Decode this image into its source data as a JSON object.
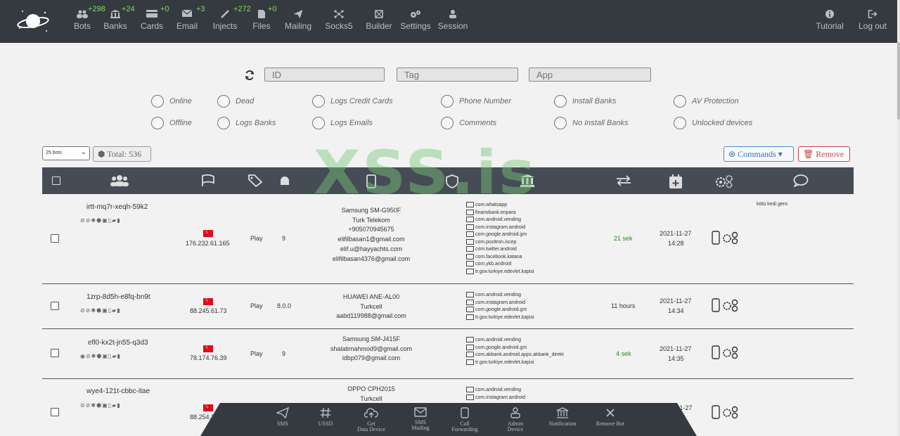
{
  "nav": [
    {
      "label": "Bots",
      "badge": "+298",
      "icon": "users-icon"
    },
    {
      "label": "Banks",
      "badge": "+24",
      "icon": "bank-icon"
    },
    {
      "label": "Cards",
      "badge": "+0",
      "icon": "card-icon"
    },
    {
      "label": "Email",
      "badge": "+3",
      "icon": "envelope-icon"
    },
    {
      "label": "Injects",
      "badge": "+272",
      "icon": "syringe-icon"
    },
    {
      "label": "Files",
      "badge": "+0",
      "icon": "file-icon"
    },
    {
      "label": "Mailing",
      "badge": "",
      "icon": "paper-plane-icon"
    },
    {
      "label": "Socks5",
      "badge": "",
      "icon": "network-icon"
    },
    {
      "label": "Builder",
      "badge": "",
      "icon": "cube-icon"
    },
    {
      "label": "Settings",
      "badge": "",
      "icon": "gears-icon"
    },
    {
      "label": "Session",
      "badge": "",
      "icon": "user-icon"
    }
  ],
  "nav_right": [
    {
      "label": "Tutorial",
      "icon": "info-icon"
    },
    {
      "label": "Log out",
      "icon": "logout-icon"
    }
  ],
  "filters": {
    "id_placeholder": "ID",
    "tag_placeholder": "Tag",
    "app_placeholder": "App"
  },
  "radios": {
    "online": "Online",
    "offline": "Offline",
    "dead": "Dead",
    "logs_banks": "Logs Banks",
    "logs_cc": "Logs Credit Cards",
    "logs_emails": "Logs Emails",
    "phone_number": "Phone Number",
    "comments": "Comments",
    "install_banks": "Install Banks",
    "no_install_banks": "No Install Banks",
    "av_protection": "AV Protection",
    "unlocked": "Unlocked devices"
  },
  "toolbar": {
    "per_page": "25 bots",
    "total": "Total: 536",
    "commands": "Commands",
    "remove": "Remove"
  },
  "watermark": "XSS.is",
  "rows": [
    {
      "id": "irtt-mq7r-xeqh-59k2",
      "ip": "176.232.61.165",
      "store": "Play",
      "android": "9",
      "device": [
        "Samsung SM-G950F",
        "Turk Telekom",
        "+905070945675",
        "elifilbasan1@gmail.com",
        "elif.u@hayyachts.com",
        "elifilbasan4376@gmail.com"
      ],
      "apps": [
        "com.whatsapp",
        "finansbank.enpara",
        "com.android.vending",
        "com.instagram.android",
        "com.google.android.gm",
        "com.pozitron.iscep",
        "com.twitter.android",
        "com.facebook.katana",
        "com.ykb.android",
        "tr.gov.turkiye.edevlet.kapisi"
      ],
      "lastseen": "21 sek",
      "date": "2021-11-27",
      "time": "14:28",
      "comment": "kötü kedi gero"
    },
    {
      "id": "1zrp-8d5h-e8fq-bn9t",
      "ip": "88.245.61.73",
      "store": "Play",
      "android": "8.0.0",
      "device": [
        "HUAWEI ANE-AL00",
        "Turkcell",
        "aabd119988@gmail.com"
      ],
      "apps": [
        "com.android.vending",
        "com.instagram.android",
        "com.google.android.gm",
        "tr.gov.turkiye.edevlet.kapisi"
      ],
      "lastseen": "11 hours",
      "date": "2021-11-27",
      "time": "14:34",
      "comment": ""
    },
    {
      "id": "efl0-kx2t-jn55-q3d3",
      "ip": "78.174.76.39",
      "store": "Play",
      "android": "9",
      "device": [
        "Samsung SM-J415F",
        "shalatimahmod9@gmail.com",
        "idbp079@gmail.com"
      ],
      "apps": [
        "com.android.vending",
        "com.google.android.gm",
        "com.akbank.android.apps.akbank_direkt",
        "tr.gov.turkiye.edevlet.kapisi"
      ],
      "lastseen": "4 sek",
      "date": "2021-11-27",
      "time": "14:35",
      "comment": ""
    },
    {
      "id": "wye4-121t-cbbc-itae",
      "ip": "88.254.2",
      "store": "",
      "android": "",
      "device": [
        "OPPO CPH2015",
        "Turkcell"
      ],
      "apps": [
        "com.android.vending",
        "com.instagram.android"
      ],
      "lastseen": "",
      "date": "11-27",
      "time": "",
      "comment": ""
    }
  ],
  "bottom": [
    {
      "l1": "SMS",
      "l2": "",
      "icon": "paper-plane-icon"
    },
    {
      "l1": "USSD",
      "l2": "",
      "icon": "hash-icon"
    },
    {
      "l1": "Get",
      "l2": "Data Device",
      "icon": "cloud-upload-icon"
    },
    {
      "l1": "SMS",
      "l2": "Mailing",
      "icon": "envelope-icon"
    },
    {
      "l1": "Call",
      "l2": "Forwarding",
      "icon": "mobile-icon"
    },
    {
      "l1": "Admin",
      "l2": "Device",
      "icon": "admin-icon"
    },
    {
      "l1": "Notification",
      "l2": "",
      "icon": "bank-icon"
    },
    {
      "l1": "Remove Bot",
      "l2": "",
      "icon": "close-icon"
    }
  ]
}
